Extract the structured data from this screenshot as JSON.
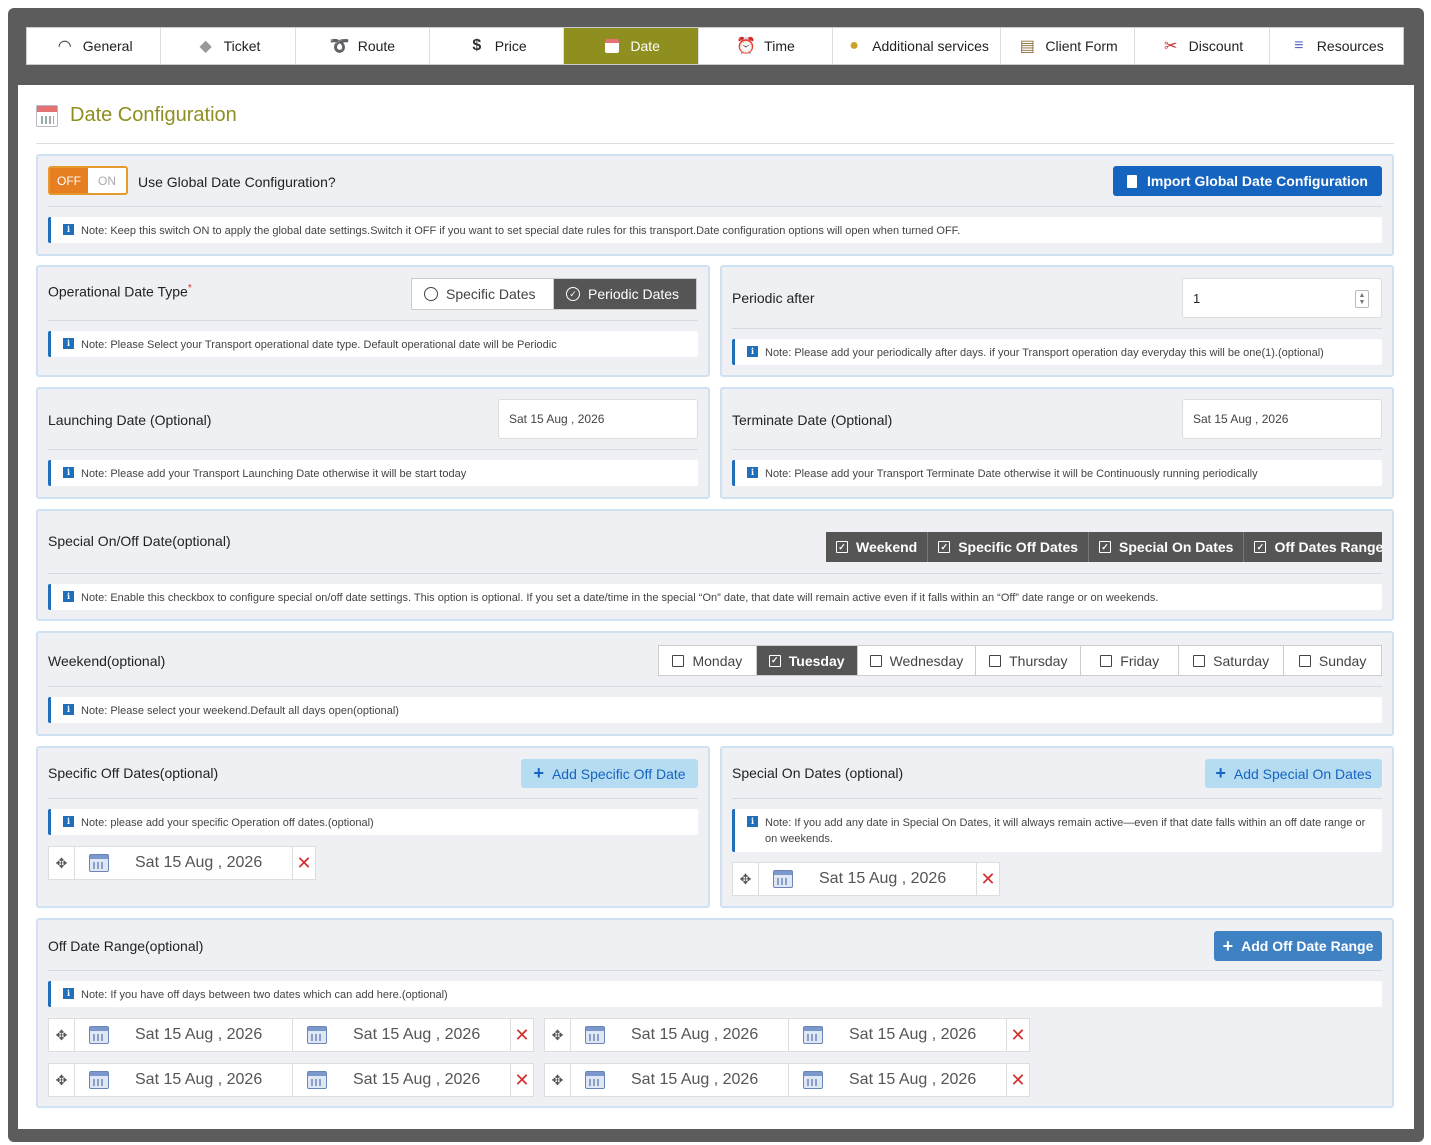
{
  "tabs": [
    {
      "label": "General",
      "icon": "wifi-icon"
    },
    {
      "label": "Ticket",
      "icon": "ticket-icon"
    },
    {
      "label": "Route",
      "icon": "route-icon"
    },
    {
      "label": "Price",
      "icon": "dollar-icon"
    },
    {
      "label": "Date",
      "icon": "calendar-icon"
    },
    {
      "label": "Time",
      "icon": "alarm-clock-icon"
    },
    {
      "label": "Additional services",
      "icon": "money-bag-icon"
    },
    {
      "label": "Client Form",
      "icon": "clipboard-icon"
    },
    {
      "label": "Discount",
      "icon": "scissors-icon"
    },
    {
      "label": "Resources",
      "icon": "books-icon"
    }
  ],
  "active_tab": "Date",
  "accent_color": "#8f8f1f",
  "page_title": "Date Configuration",
  "global": {
    "toggle_off": "OFF",
    "toggle_on": "ON",
    "label": "Use Global Date Configuration?",
    "import_button": "Import Global Date Configuration",
    "note": "Note: Keep this switch ON to apply the global date settings.Switch it OFF if you want to set special date rules for this transport.Date configuration options will open when turned OFF."
  },
  "operational": {
    "label": "Operational Date Type",
    "required_mark": "*",
    "options": [
      "Specific Dates",
      "Periodic Dates"
    ],
    "selected": "Periodic Dates",
    "note": "Note: Please Select your Transport operational date type. Default operational date will be Periodic"
  },
  "periodic": {
    "label": "Periodic after",
    "value": "1",
    "note": "Note: Please add your periodically after days. if your Transport operation day everyday this will be one(1).(optional)"
  },
  "launching": {
    "label": "Launching Date (Optional)",
    "value": "Sat 15 Aug , 2026",
    "note": "Note: Please add your Transport Launching Date otherwise it will be start today"
  },
  "terminate": {
    "label": "Terminate Date (Optional)",
    "value": "Sat 15 Aug , 2026",
    "note": "Note: Please add your Transport Terminate Date otherwise it will be Continuously running periodically"
  },
  "special_onoff": {
    "label": "Special On/Off Date(optional)",
    "options": [
      "Weekend",
      "Specific Off Dates",
      "Special On Dates",
      "Off Dates Range"
    ],
    "note": "Note: Enable this checkbox to configure special on/off date settings. This option is optional. If you set a date/time in the special “On” date, that date will remain active even if it falls within an “Off” date range or on weekends."
  },
  "weekend": {
    "label": "Weekend(optional)",
    "days": [
      "Monday",
      "Tuesday",
      "Wednesday",
      "Thursday",
      "Friday",
      "Saturday",
      "Sunday"
    ],
    "checked": "Tuesday",
    "note": "Note: Please select your weekend.Default all days open(optional)"
  },
  "specific_off": {
    "label": "Specific Off Dates(optional)",
    "button": "Add Specific Off Date",
    "note": "Note: please add your specific Operation off dates.(optional)",
    "dates": [
      "Sat 15 Aug , 2026"
    ]
  },
  "special_on": {
    "label": "Special On Dates (optional)",
    "button": "Add Special On Dates",
    "note": "Note: If you add any date in Special On Dates, it will always remain active—even if that date falls within an off date range or on weekends.",
    "dates": [
      "Sat 15 Aug , 2026"
    ]
  },
  "off_range": {
    "label": "Off Date Range(optional)",
    "button": "Add Off Date Range",
    "note": "Note: If you have off days between two dates which can add here.(optional)",
    "ranges": [
      {
        "from": "Sat 15 Aug , 2026",
        "to": "Sat 15 Aug , 2026"
      },
      {
        "from": "Sat 15 Aug , 2026",
        "to": "Sat 15 Aug , 2026"
      },
      {
        "from": "Sat 15 Aug , 2026",
        "to": "Sat 15 Aug , 2026"
      },
      {
        "from": "Sat 15 Aug , 2026",
        "to": "Sat 15 Aug , 2026"
      }
    ]
  }
}
